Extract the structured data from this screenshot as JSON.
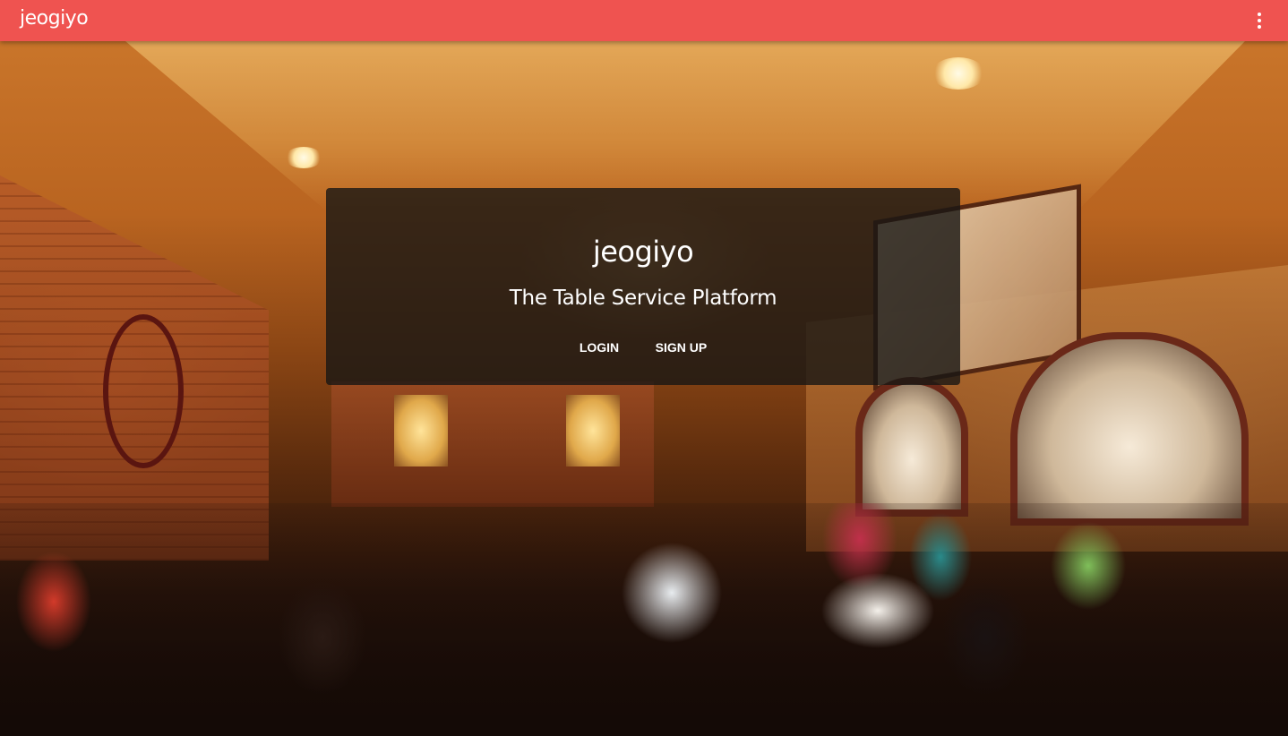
{
  "appbar": {
    "brand": "jeogiyo",
    "menu_icon": "more-vert-icon",
    "color": "#ef5350"
  },
  "hero": {
    "background": "restaurant-dining-room-photo"
  },
  "card": {
    "title": "jeogiyo",
    "subtitle": "The Table Service Platform",
    "login_label": "LOGIN",
    "signup_label": "SIGN UP"
  }
}
